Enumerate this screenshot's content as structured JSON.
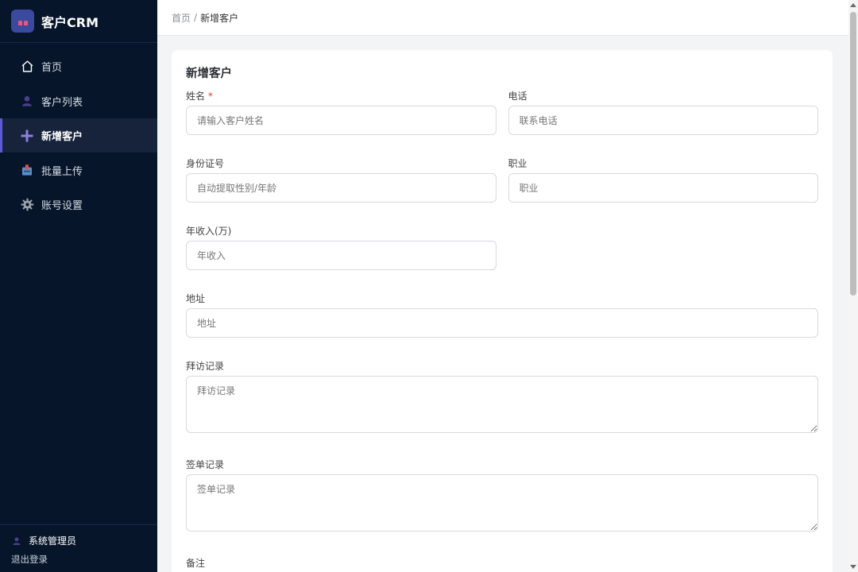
{
  "brand": {
    "title": "客户CRM"
  },
  "nav": {
    "items": [
      {
        "label": "首页",
        "icon": "home-icon"
      },
      {
        "label": "客户列表",
        "icon": "user-icon"
      },
      {
        "label": "新增客户",
        "icon": "plus-icon"
      },
      {
        "label": "批量上传",
        "icon": "inbox-icon"
      },
      {
        "label": "账号设置",
        "icon": "gear-icon"
      }
    ],
    "active": "新增客户"
  },
  "footer": {
    "user": "系统管理员",
    "logout": "退出登录"
  },
  "breadcrumb": {
    "home": "首页",
    "separator": "/",
    "current": "新增客户"
  },
  "form": {
    "title": "新增客户",
    "name": {
      "label": "姓名",
      "required": "*",
      "placeholder": "请输入客户姓名"
    },
    "phone": {
      "label": "电话",
      "placeholder": "联系电话"
    },
    "id_card": {
      "label": "身份证号",
      "placeholder": "自动提取性别/年龄"
    },
    "job": {
      "label": "职业",
      "placeholder": "职业"
    },
    "income": {
      "label": "年收入(万)",
      "placeholder": "年收入"
    },
    "address": {
      "label": "地址",
      "placeholder": "地址"
    },
    "visit": {
      "label": "拜访记录",
      "placeholder": "拜访记录"
    },
    "sign": {
      "label": "签单记录",
      "placeholder": "签单记录"
    },
    "remark": {
      "label": "备注"
    }
  },
  "colors": {
    "sidebar_bg": "#061529",
    "active_accent": "#5b5bd6",
    "page_bg": "#f3f4f6",
    "required": "#e53e3e"
  }
}
